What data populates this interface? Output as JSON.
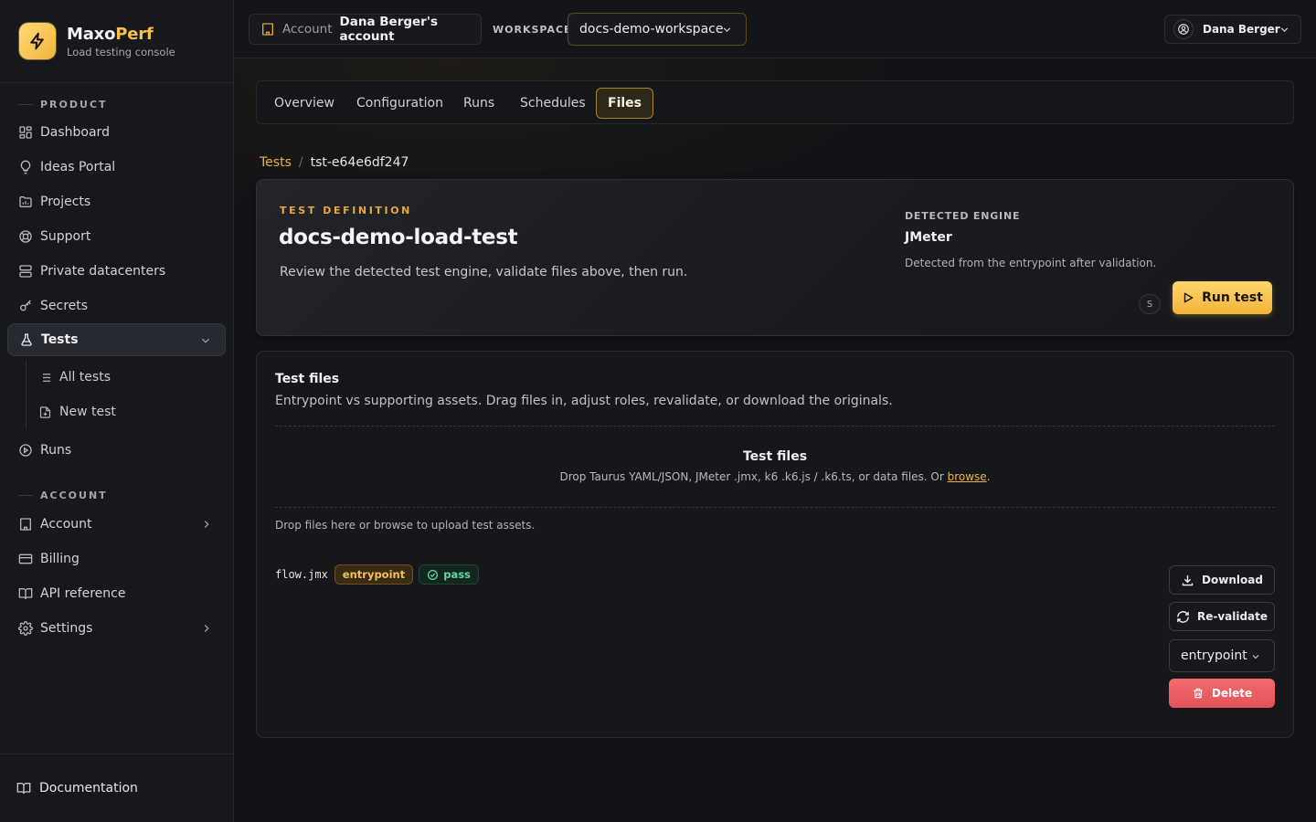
{
  "brand": {
    "name_prefix": "Maxo",
    "name_accent": "Perf",
    "subtitle": "Load testing console"
  },
  "sidebar": {
    "sections": {
      "product": "PRODUCT",
      "account": "ACCOUNT"
    },
    "items": {
      "dashboard": "Dashboard",
      "ideas_portal": "Ideas Portal",
      "projects": "Projects",
      "support": "Support",
      "private_datacenters": "Private datacenters",
      "secrets": "Secrets",
      "tests": "Tests",
      "all_tests": "All tests",
      "new_test": "New test",
      "runs": "Runs",
      "account": "Account",
      "billing": "Billing",
      "api_reference": "API reference",
      "settings": "Settings"
    },
    "footer": "Documentation"
  },
  "topbar": {
    "account_label": "Account",
    "account_value": "Dana Berger's account",
    "workspace_label": "WORKSPACE",
    "workspace_value": "docs-demo-workspace",
    "user_name": "Dana Berger"
  },
  "tabs": [
    "Overview",
    "Configuration",
    "Runs",
    "Schedules",
    "Files"
  ],
  "active_tab": "Files",
  "breadcrumb": {
    "parent": "Tests",
    "separator": "/",
    "current": "tst-e64e6df247"
  },
  "definition": {
    "kicker": "TEST DEFINITION",
    "title": "docs-demo-load-test",
    "description": "Review the detected test engine, validate files above, then run.",
    "engine_label": "DETECTED ENGINE",
    "engine_name": "JMeter",
    "engine_note": "Detected from the entrypoint after validation.",
    "shortcut": "S",
    "run_label": "Run test"
  },
  "files": {
    "title": "Test files",
    "description": "Entrypoint vs supporting assets. Drag files in, adjust roles, revalidate, or download the originals.",
    "drop_title": "Test files",
    "drop_sub_before": "Drop Taurus YAML/JSON, JMeter .jmx, k6 .k6.js / .k6.ts, or data files. Or ",
    "drop_sub_link": "browse",
    "drop_sub_after": ".",
    "drop_hint": "Drop files here or browse to upload test assets.",
    "rows": [
      {
        "name": "flow.jmx",
        "role_badge": "entrypoint",
        "status": "pass",
        "download_label": "Download",
        "revalidate_label": "Re-validate",
        "role_select": "entrypoint",
        "delete_label": "Delete"
      }
    ]
  },
  "colors": {
    "accent": "#f5c046",
    "danger": "#e4545a",
    "success": "#62d6a4"
  }
}
